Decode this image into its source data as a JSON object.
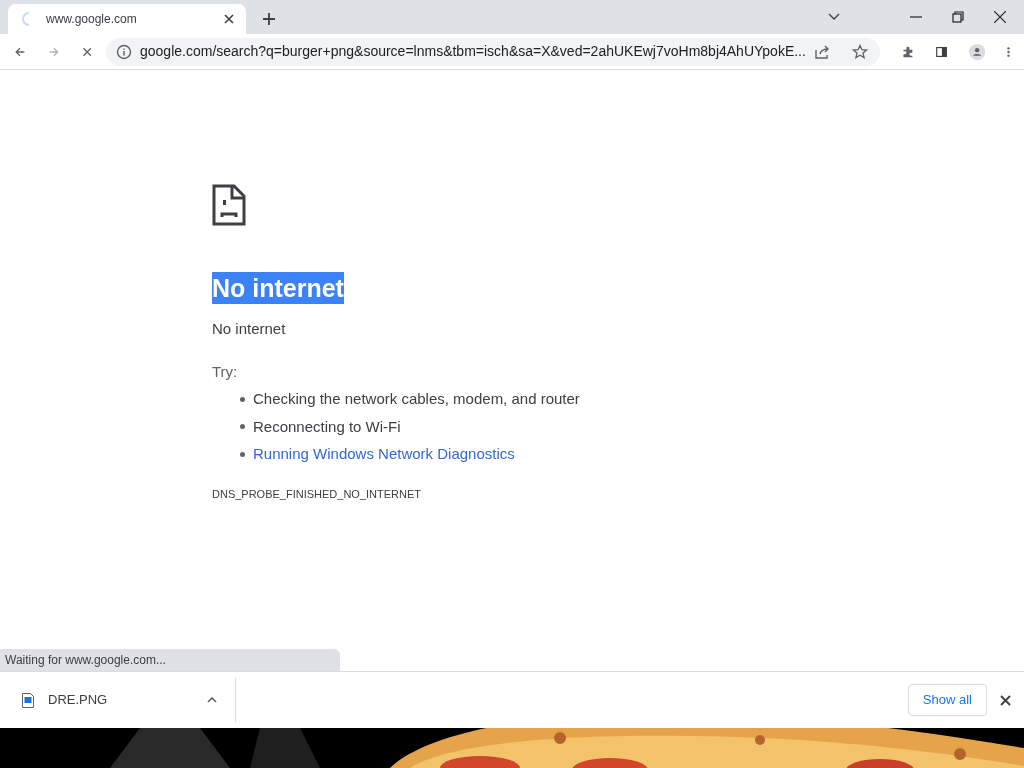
{
  "tab": {
    "title": "www.google.com",
    "loading": true
  },
  "address_bar": {
    "url": "google.com/search?q=burger+png&source=lnms&tbm=isch&sa=X&ved=2ahUKEwj7voHm8bj4AhUYpokE..."
  },
  "error_page": {
    "heading": "No internet",
    "heading_selected": true,
    "message": "No internet",
    "try_label": "Try:",
    "suggestions": [
      {
        "text": "Checking the network cables, modem, and router",
        "kind": "text"
      },
      {
        "text": "Reconnecting to Wi-Fi",
        "kind": "text"
      },
      {
        "text": "Running Windows Network Diagnostics",
        "kind": "link"
      }
    ],
    "error_code": "DNS_PROBE_FINISHED_NO_INTERNET"
  },
  "status_bubble": "Waiting for www.google.com...",
  "download_shelf": {
    "items": [
      {
        "name": "DRE.PNG"
      }
    ],
    "show_all": "Show all"
  }
}
